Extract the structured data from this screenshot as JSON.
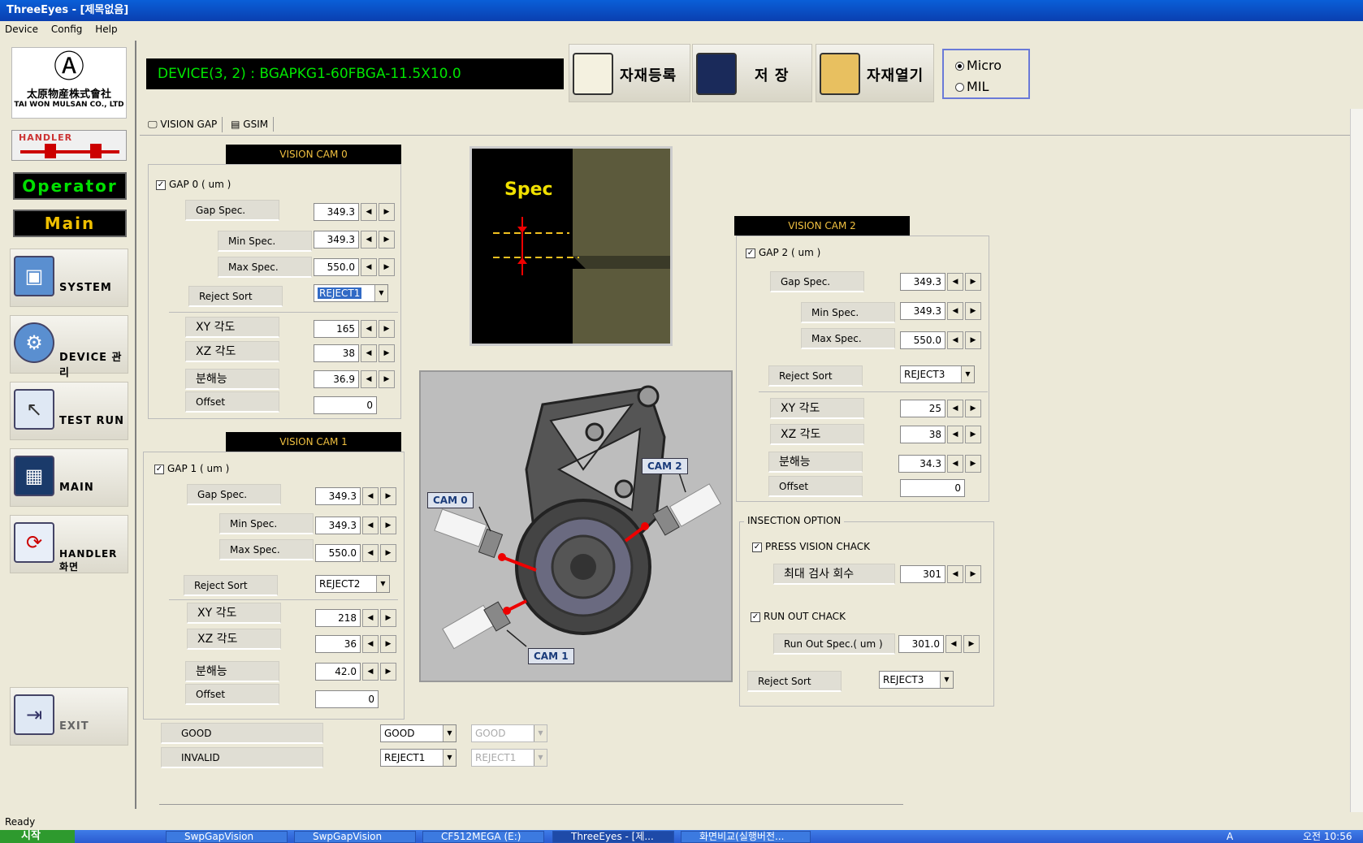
{
  "window": {
    "title": "ThreeEyes - [제목없음]"
  },
  "menu": [
    "Device",
    "Config",
    "Help"
  ],
  "sidebar": {
    "logo_kor": "太原物産株式會社",
    "logo_eng": "TAI WON MULSAN CO., LTD",
    "handler_logo": "HANDLER",
    "operator": "Operator",
    "main_disp": "Main",
    "nav": [
      {
        "label": "SYSTEM",
        "icon": "system-icon"
      },
      {
        "label": "DEVICE 관리",
        "icon": "device-icon"
      },
      {
        "label": "TEST RUN",
        "icon": "test-run-icon"
      },
      {
        "label": "MAIN",
        "icon": "main-grid-icon"
      },
      {
        "label": "HANDLER 화면",
        "icon": "handler-icon"
      }
    ],
    "exit": "EXIT"
  },
  "toolbar": {
    "device": "DEVICE(3, 2) : BGAPKG1-60FBGA-11.5X10.0",
    "register": "자재등록",
    "save": "저  장",
    "open": "자재열기",
    "unit_micro": "Micro",
    "unit_mil": "MIL",
    "unit_selected": "Micro"
  },
  "tabs": [
    "VISION GAP",
    "GSIM"
  ],
  "cam0": {
    "header": "VISION CAM 0",
    "gap_label": "GAP 0 ( um )",
    "gap_checked": true,
    "gap_spec_label": "Gap Spec.",
    "gap_spec": "349.3",
    "min_label": "Min Spec.",
    "min": "349.3",
    "max_label": "Max Spec.",
    "max": "550.0",
    "reject_label": "Reject Sort",
    "reject": "REJECT1",
    "xy_label": "XY 각도",
    "xy": "165",
    "xz_label": "XZ 각도",
    "xz": "38",
    "res_label": "분해능",
    "res": "36.9",
    "offset_label": "Offset",
    "offset": "0"
  },
  "cam1": {
    "header": "VISION CAM 1",
    "gap_label": "GAP 1 ( um )",
    "gap_checked": true,
    "gap_spec_label": "Gap Spec.",
    "gap_spec": "349.3",
    "min_label": "Min Spec.",
    "min": "349.3",
    "max_label": "Max Spec.",
    "max": "550.0",
    "reject_label": "Reject Sort",
    "reject": "REJECT2",
    "xy_label": "XY 각도",
    "xy": "218",
    "xz_label": "XZ 각도",
    "xz": "36",
    "res_label": "분해능",
    "res": "42.0",
    "offset_label": "Offset",
    "offset": "0"
  },
  "cam2": {
    "header": "VISION CAM 2",
    "gap_label": "GAP 2 ( um )",
    "gap_checked": true,
    "gap_spec_label": "Gap Spec.",
    "gap_spec": "349.3",
    "min_label": "Min Spec.",
    "min": "349.3",
    "max_label": "Max Spec.",
    "max": "550.0",
    "reject_label": "Reject Sort",
    "reject": "REJECT3",
    "xy_label": "XY 각도",
    "xy": "25",
    "xz_label": "XZ 각도",
    "xz": "38",
    "res_label": "분해능",
    "res": "34.3",
    "offset_label": "Offset",
    "offset": "0"
  },
  "spec_image": {
    "label": "Spec"
  },
  "machine_image": {
    "cam0": "CAM 0",
    "cam1": "CAM 1",
    "cam2": "CAM 2"
  },
  "inspection": {
    "title": "INSECTION OPTION",
    "press_label": "PRESS VISION CHACK",
    "press_checked": true,
    "max_count_label": "최대 검사 회수",
    "max_count": "301",
    "runout_label": "RUN OUT CHACK",
    "runout_checked": true,
    "runout_spec_label": "Run Out Spec.( um )",
    "runout_spec": "301.0",
    "reject_label": "Reject Sort",
    "reject": "REJECT3"
  },
  "results": {
    "good_label": "GOOD",
    "good_combo": "GOOD",
    "good_combo2": "GOOD",
    "invalid_label": "INVALID",
    "invalid_combo": "REJECT1",
    "invalid_combo2": "REJECT1"
  },
  "status": {
    "text": "Ready"
  },
  "taskbar": {
    "start": "시작",
    "items": [
      "SwpGapVision",
      "SwpGapVision",
      "CF512MEGA (E:)",
      "ThreeEyes - [제...",
      "화면비교(실행버전..."
    ],
    "clock": "오전 10:56",
    "ime": "A"
  }
}
